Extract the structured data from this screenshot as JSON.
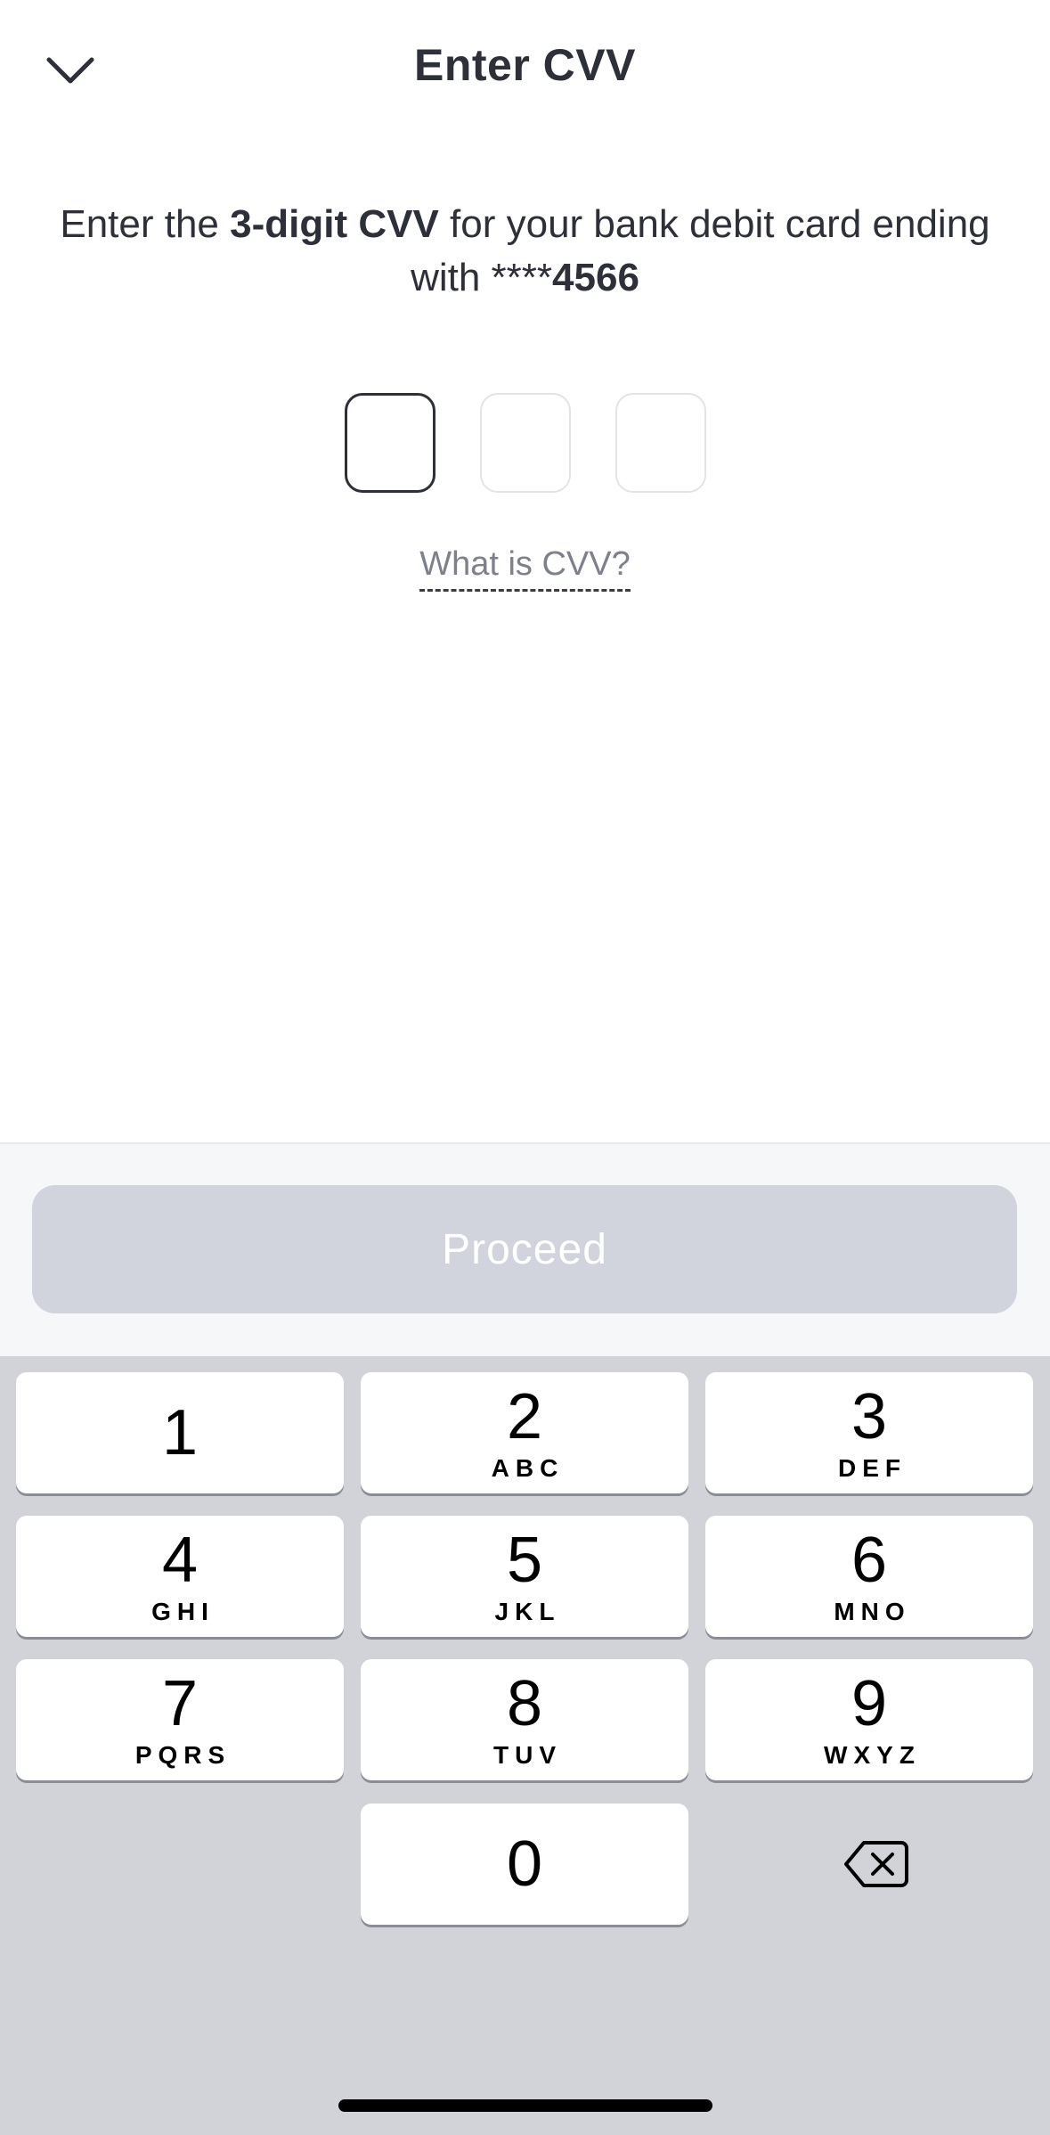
{
  "header": {
    "title": "Enter CVV"
  },
  "instruction": {
    "part1": "Enter the ",
    "bold1": "3-digit CVV",
    "part2": " for your  bank debit card ending with ****",
    "bold2": "4566"
  },
  "cvv": {
    "digit_count": 3,
    "filled": 0
  },
  "help_link": "What is CVV?",
  "proceed_label": "Proceed",
  "keypad": {
    "keys": [
      {
        "digit": "1",
        "letters": ""
      },
      {
        "digit": "2",
        "letters": "ABC"
      },
      {
        "digit": "3",
        "letters": "DEF"
      },
      {
        "digit": "4",
        "letters": "GHI"
      },
      {
        "digit": "5",
        "letters": "JKL"
      },
      {
        "digit": "6",
        "letters": "MNO"
      },
      {
        "digit": "7",
        "letters": "PQRS"
      },
      {
        "digit": "8",
        "letters": "TUV"
      },
      {
        "digit": "9",
        "letters": "WXYZ"
      },
      {
        "digit": "0",
        "letters": ""
      }
    ]
  },
  "colors": {
    "text": "#2d3039",
    "button_disabled": "#d1d4dc",
    "keypad_bg": "#d1d3d9"
  }
}
